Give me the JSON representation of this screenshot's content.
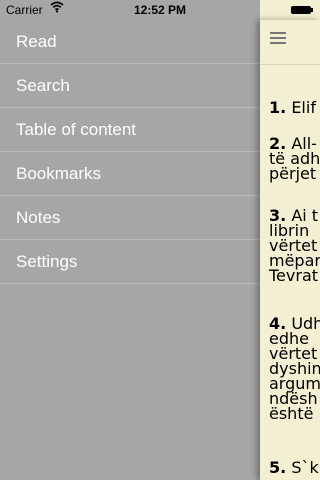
{
  "status_bar": {
    "carrier": "Carrier",
    "time": "12:52 PM",
    "wifi_icon": "wifi-icon",
    "battery_icon": "battery-icon"
  },
  "menu": [
    {
      "label": "Read"
    },
    {
      "label": "Search"
    },
    {
      "label": "Table of content"
    },
    {
      "label": "Bookmarks"
    },
    {
      "label": "Notes"
    },
    {
      "label": "Settings"
    }
  ],
  "content": {
    "menu_icon": "hamburger-menu-icon",
    "verses": [
      {
        "number": "1.",
        "lines": [
          "Elif"
        ]
      },
      {
        "number": "2.",
        "lines": [
          "All-",
          "të adh",
          "përjet"
        ]
      },
      {
        "number": "3.",
        "lines": [
          "Ai t",
          "librin",
          "vërtet",
          "mëpar",
          "Tevrat"
        ]
      },
      {
        "number": "4.",
        "lines": [
          "Udh",
          "edhe",
          "vërtet",
          "dyshin",
          "argum",
          "ndësh",
          "është"
        ]
      },
      {
        "number": "5.",
        "lines": [
          "S`k"
        ]
      }
    ]
  },
  "colors": {
    "sidebar": "#a6a6a6",
    "page": "#f2efd2",
    "menu_text": "#ffffff"
  }
}
